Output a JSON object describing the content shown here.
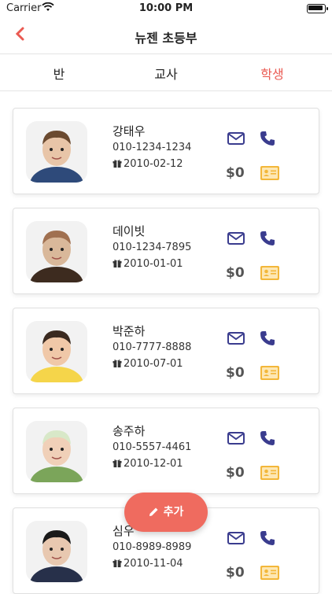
{
  "status": {
    "carrier": "Carrier",
    "time": "10:00 PM"
  },
  "nav": {
    "back_icon": "chevron-left-icon",
    "title": "뉴젠 초등부"
  },
  "tabs": [
    {
      "label": "반",
      "active": false
    },
    {
      "label": "교사",
      "active": false
    },
    {
      "label": "학생",
      "active": true
    }
  ],
  "students": [
    {
      "name": "강태우",
      "phone": "010-1234-1234",
      "birthday": "2010-02-12",
      "balance": "$0"
    },
    {
      "name": "데이빗",
      "phone": "010-1234-7895",
      "birthday": "2010-01-01",
      "balance": "$0"
    },
    {
      "name": "박준하",
      "phone": "010-7777-8888",
      "birthday": "2010-07-01",
      "balance": "$0"
    },
    {
      "name": "송주하",
      "phone": "010-5557-4461",
      "birthday": "2010-12-01",
      "balance": "$0"
    },
    {
      "name": "심우",
      "phone": "010-8989-8989",
      "birthday": "2010-11-04",
      "balance": "$0"
    }
  ],
  "fab": {
    "label": "추가",
    "icon": "pencil-icon"
  },
  "colors": {
    "accent": "#ea5a52",
    "icon_blue": "#3a3c8e",
    "icon_yellow": "#f3b73a"
  }
}
